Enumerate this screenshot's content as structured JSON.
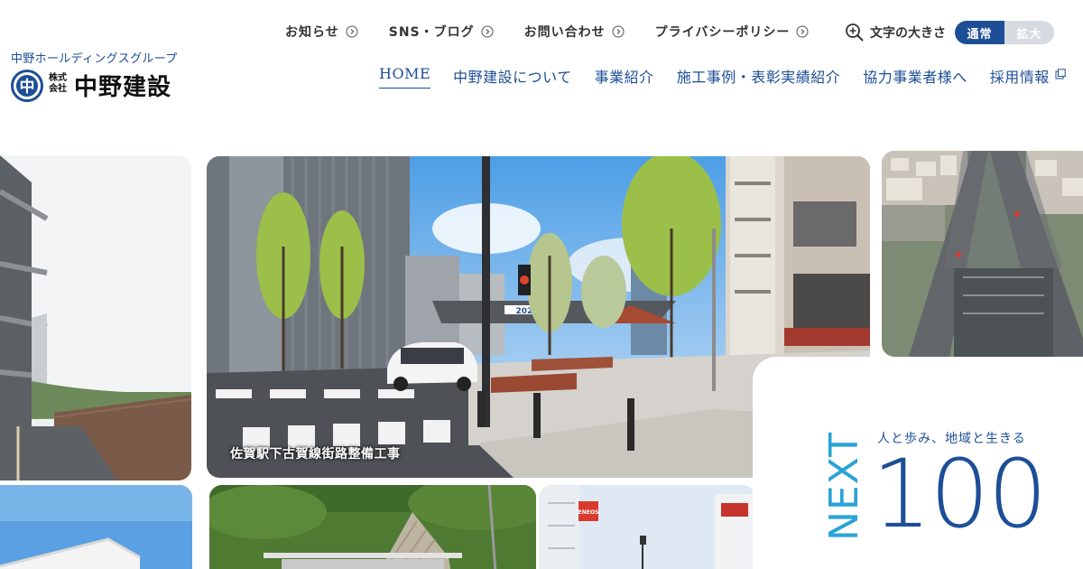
{
  "brand": {
    "group": "中野ホールディングスグループ",
    "kabushiki": "株式会社",
    "name": "中野建設",
    "mark_char": "中",
    "primary_color": "#1d4f96",
    "accent_color": "#29a3d6"
  },
  "util_nav": {
    "items": [
      {
        "label": "お知らせ",
        "icon": "circle-arrow-icon"
      },
      {
        "label": "SNS・ブログ",
        "icon": "circle-arrow-icon"
      },
      {
        "label": "お問い合わせ",
        "icon": "circle-arrow-icon"
      },
      {
        "label": "プライバシーポリシー",
        "icon": "circle-arrow-icon"
      }
    ]
  },
  "font_size": {
    "label": "文字の大きさ",
    "icon": "zoom-in-icon",
    "options": [
      "通常",
      "拡大"
    ],
    "selected": "通常"
  },
  "main_nav": {
    "items": [
      {
        "label": "HOME",
        "active": true
      },
      {
        "label": "中野建設について",
        "active": false
      },
      {
        "label": "事業紹介",
        "active": false
      },
      {
        "label": "施工事例・表彰実績紹介",
        "active": false
      },
      {
        "label": "協力事業者様へ",
        "active": false
      },
      {
        "label": "採用情報",
        "active": false,
        "icon": "external-link-icon"
      }
    ]
  },
  "hero": {
    "caption": "佐賀駅下古賀線街路整備工事",
    "signs": {
      "eneos": "ENEOS",
      "year": "2024"
    }
  },
  "next_card": {
    "vertical": "NEXT",
    "slogan": "人と歩み、地域と生きる",
    "number": "100"
  }
}
